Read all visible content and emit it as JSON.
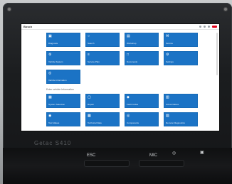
{
  "device": {
    "brand_label": "Getac S410",
    "hardware_keys": {
      "left_key_label": "ESC",
      "right_key_label": "MIC"
    }
  },
  "app": {
    "title": "Bosch",
    "tiles_top": [
      {
        "icon": "car-icon",
        "label": "Diagnosis"
      },
      {
        "icon": "search-icon",
        "label": "Search"
      },
      {
        "icon": "book-icon",
        "label": "Workshop"
      },
      {
        "icon": "wrench-icon",
        "label": "Service"
      },
      {
        "icon": "gear-icon",
        "label": "Vehicle System"
      },
      {
        "icon": "list-icon",
        "label": "Service Plan"
      },
      {
        "icon": "document-icon",
        "label": "Documents"
      },
      {
        "icon": "settings-icon",
        "label": "Settings"
      },
      {
        "icon": "info-icon",
        "label": "Vehicle Information"
      }
    ],
    "section_label": "Enter vehicle Information",
    "tiles_bottom": [
      {
        "icon": "diagnostic-icon",
        "label": "System Selection"
      },
      {
        "icon": "chat-icon",
        "label": "Repair"
      },
      {
        "icon": "tag-icon",
        "label": "Fault Codes"
      },
      {
        "icon": "clipboard-icon",
        "label": "Actual Values"
      },
      {
        "icon": "pin-icon",
        "label": "Test Values"
      },
      {
        "icon": "calendar-icon",
        "label": "Technical Data"
      },
      {
        "icon": "help-icon",
        "label": "Components"
      },
      {
        "icon": "phone-icon",
        "label": "Remote Diagnostics"
      }
    ],
    "tile_color": "#1b73c5",
    "accent_color": "#e2001a"
  }
}
